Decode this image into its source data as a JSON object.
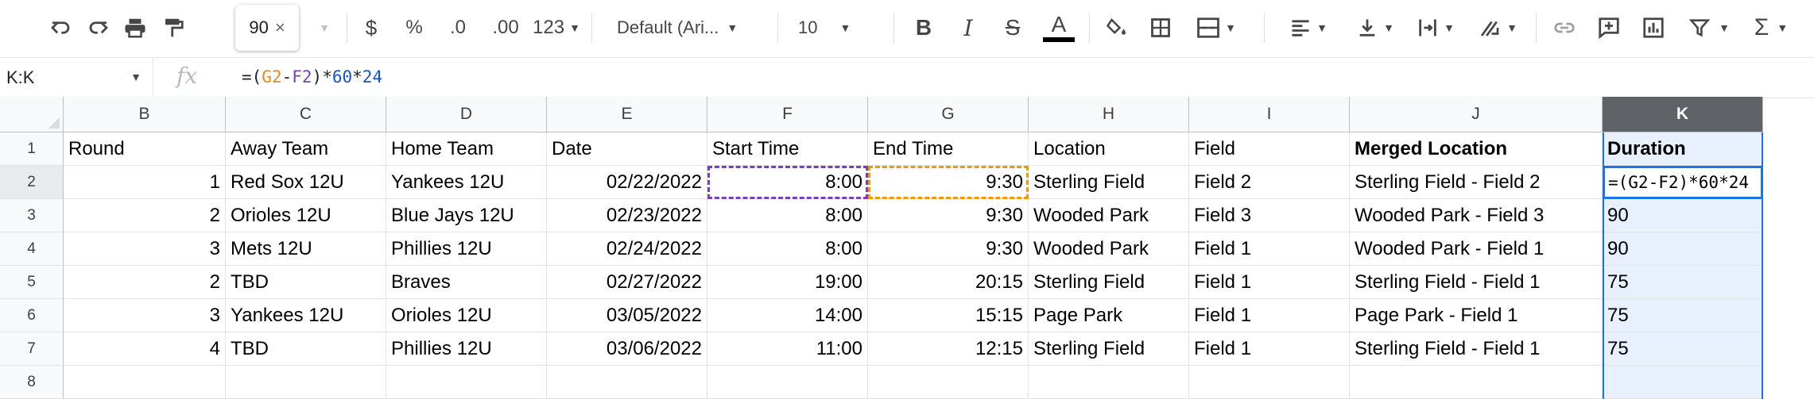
{
  "toolbar": {
    "zoom_tooltip": "90",
    "currency_label": "$",
    "percent_label": "%",
    "decrease_decimal_label": ".0",
    "increase_decimal_label": ".00",
    "more_formats_label": "123",
    "font_family": "Default (Ari...",
    "font_size": "10",
    "bold_label": "B",
    "italic_label": "I",
    "strike_label": "S",
    "text_color_label": "A",
    "text_color_swatch": "#000000",
    "functions_label": "Σ"
  },
  "formula_bar": {
    "name_box": "K:K",
    "fx_label": "fx",
    "formula": {
      "p1": "=(",
      "g": "G2",
      "minus": "-",
      "f": "F2",
      "rest": ")*",
      "n1": "60",
      "times": "*",
      "n2": "24"
    }
  },
  "colors": {
    "accent": "#1a73e8",
    "ref_f": "#7a3ebd",
    "ref_g": "#f29900",
    "selected_header": "#5f6368",
    "selected_column_fill": "#e8f0fe"
  },
  "grid": {
    "columns": [
      "B",
      "C",
      "D",
      "E",
      "F",
      "G",
      "H",
      "I",
      "J",
      "K"
    ],
    "row_numbers": [
      "1",
      "2",
      "3",
      "4",
      "5",
      "6",
      "7",
      "8"
    ],
    "header_row": [
      "Round",
      "Away Team",
      "Home Team",
      "Date",
      "Start Time",
      "End Time",
      "Location",
      "Field",
      "Merged Location",
      "Duration"
    ],
    "rows": [
      [
        "1",
        "Red Sox 12U",
        "Yankees 12U",
        "02/22/2022",
        "8:00",
        "9:30",
        "Sterling Field",
        "Field 2",
        "Sterling Field - Field 2",
        "=(G2-F2)*60*24"
      ],
      [
        "2",
        "Orioles 12U",
        "Blue Jays 12U",
        "02/23/2022",
        "8:00",
        "9:30",
        "Wooded Park",
        "Field 3",
        "Wooded Park - Field 3",
        "90"
      ],
      [
        "3",
        "Mets 12U",
        "Phillies 12U",
        "02/24/2022",
        "8:00",
        "9:30",
        "Wooded Park",
        "Field 1",
        "Wooded Park - Field 1",
        "90"
      ],
      [
        "2",
        "TBD",
        "Braves",
        "02/27/2022",
        "19:00",
        "20:15",
        "Sterling Field",
        "Field 1",
        "Sterling Field - Field 1",
        "75"
      ],
      [
        "3",
        "Yankees 12U",
        "Orioles 12U",
        "03/05/2022",
        "14:00",
        "15:15",
        "Page Park",
        "Field 1",
        "Page Park - Field 1",
        "75"
      ],
      [
        "4",
        "TBD",
        "Phillies 12U",
        "03/06/2022",
        "11:00",
        "12:15",
        "Sterling Field",
        "Field 1",
        "Sterling Field - Field 1",
        "75"
      ]
    ]
  }
}
